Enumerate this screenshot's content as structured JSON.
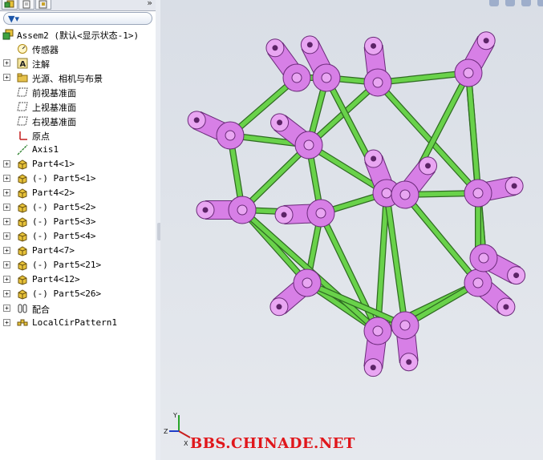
{
  "feature_tree": {
    "root": "Assem2  (默认<显示状态-1>)",
    "items": [
      {
        "label": "传感器",
        "icon": "sensor-icon",
        "expandable": false
      },
      {
        "label": "注解",
        "icon": "annotation-icon",
        "expandable": true
      },
      {
        "label": "光源、相机与布景",
        "icon": "lights-folder-icon",
        "expandable": true
      },
      {
        "label": "前视基准面",
        "icon": "plane-icon",
        "expandable": false
      },
      {
        "label": "上视基准面",
        "icon": "plane-icon",
        "expandable": false
      },
      {
        "label": "右视基准面",
        "icon": "plane-icon",
        "expandable": false
      },
      {
        "label": "原点",
        "icon": "origin-icon",
        "expandable": false
      },
      {
        "label": "Axis1",
        "icon": "axis-icon",
        "expandable": false
      },
      {
        "label": "Part4<1>",
        "icon": "part-icon",
        "expandable": true
      },
      {
        "label": "(-) Part5<1>",
        "icon": "part-icon",
        "expandable": true
      },
      {
        "label": "Part4<2>",
        "icon": "part-icon",
        "expandable": true
      },
      {
        "label": "(-) Part5<2>",
        "icon": "part-icon",
        "expandable": true
      },
      {
        "label": "(-) Part5<3>",
        "icon": "part-icon",
        "expandable": true
      },
      {
        "label": "(-) Part5<4>",
        "icon": "part-icon",
        "expandable": true
      },
      {
        "label": "Part4<7>",
        "icon": "part-icon",
        "expandable": true
      },
      {
        "label": "(-) Part5<21>",
        "icon": "part-icon",
        "expandable": true
      },
      {
        "label": "Part4<12>",
        "icon": "part-icon",
        "expandable": true
      },
      {
        "label": "(-) Part5<26>",
        "icon": "part-icon",
        "expandable": true
      },
      {
        "label": "配合",
        "icon": "mates-icon",
        "expandable": true
      },
      {
        "label": "LocalCirPattern1",
        "icon": "pattern-icon",
        "expandable": true
      }
    ]
  },
  "tabs": [
    "feature-manager-icon",
    "property-manager-icon",
    "configuration-manager-icon"
  ],
  "triad": {
    "x": "X",
    "y": "Y",
    "z": "Z"
  },
  "watermark": "BBS.CHINADE.NET",
  "colors": {
    "hub": "#d77fe6",
    "rod": "#69d24a",
    "background": "#dde1e8"
  }
}
